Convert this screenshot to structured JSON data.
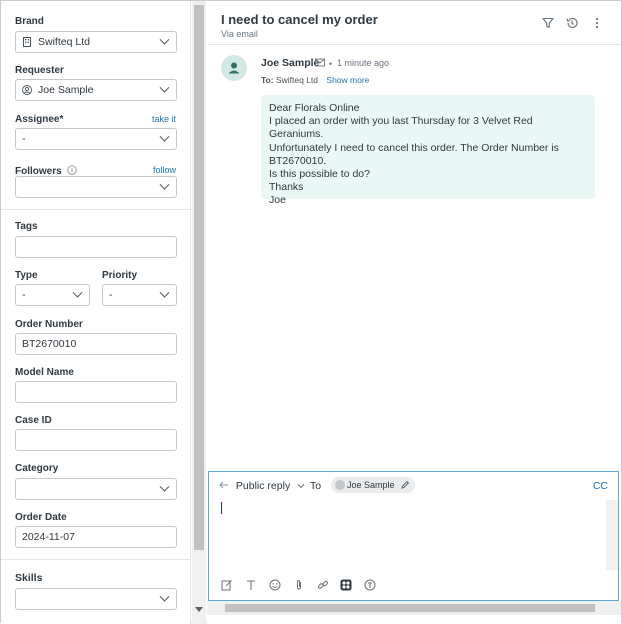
{
  "left_panel": {
    "brand": {
      "label": "Brand",
      "value": "Swifteq Ltd"
    },
    "requester": {
      "label": "Requester",
      "value": "Joe Sample"
    },
    "assignee": {
      "label": "Assignee*",
      "action": "take it",
      "value": "-"
    },
    "followers": {
      "label": "Followers",
      "action": "follow",
      "value": ""
    },
    "tags": {
      "label": "Tags",
      "value": ""
    },
    "type": {
      "label": "Type",
      "value": "-"
    },
    "priority": {
      "label": "Priority",
      "value": "-"
    },
    "order_number": {
      "label": "Order Number",
      "value": "BT2670010"
    },
    "model_name": {
      "label": "Model Name",
      "value": ""
    },
    "case_id": {
      "label": "Case ID",
      "value": ""
    },
    "category": {
      "label": "Category",
      "value": ""
    },
    "order_date": {
      "label": "Order Date",
      "value": "2024-11-07"
    },
    "skills": {
      "label": "Skills",
      "value": ""
    }
  },
  "ticket": {
    "title": "I need to cancel my order",
    "channel": "Via email"
  },
  "message": {
    "sender": "Joe Sample",
    "time": "1 minute ago",
    "to_label": "To:",
    "to_value": "Swifteq Ltd",
    "show_more": "Show more",
    "body_lines": [
      "Dear Florals Online",
      "I placed an order with you last Thursday for 3 Velvet Red Geraniums.",
      "Unfortunately I need to cancel this order. The Order Number is BT2670010.",
      "Is this possible to do?",
      "Thanks",
      "Joe"
    ]
  },
  "composer": {
    "reply_type": "Public reply",
    "to_label": "To",
    "recipient": "Joe Sample",
    "cc_label": "CC"
  },
  "icons": {
    "brand": "building-icon",
    "requester": "user-icon",
    "info": "info-icon",
    "filter": "filter-icon",
    "history": "history-icon",
    "more": "more-vertical-icon",
    "mail": "mail-icon"
  },
  "colors": {
    "accent": "#1f73b7",
    "bubble": "#e9f7f5",
    "avatar": "#d1e8e4"
  }
}
